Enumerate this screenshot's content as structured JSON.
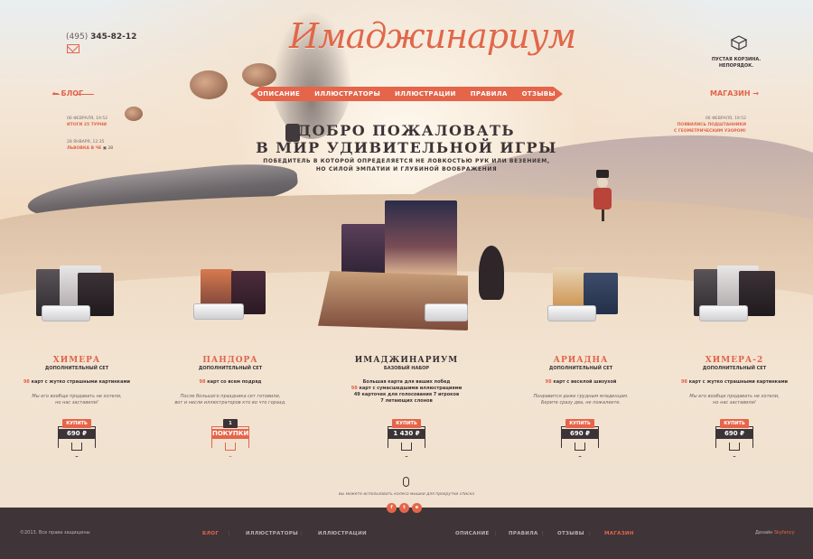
{
  "header": {
    "phone_code": "(495)",
    "phone_number": "345-82-12",
    "logo": "Имаджинариум",
    "nav": [
      "ОПИСАНИЕ",
      "ИЛЛЮСТРАТОРЫ",
      "ИЛЛЮСТРАЦИИ",
      "ПРАВИЛА",
      "ОТЗЫВЫ"
    ],
    "cart_text_1": "ПУСТАЯ КОРЗИНА.",
    "cart_text_2": "НЕПОРЯДОК.",
    "blog_label": "БЛОГ",
    "shop_label": "МАГАЗИН"
  },
  "blog_news": [
    {
      "date": "06 ФЕВРАЛЯ, 19:52",
      "title": "ИТОГИ 25 ТУРНИ"
    },
    {
      "date": "28 ЯНВАРЯ, 12:35",
      "title": "ЛЬВОВКА В ЧЕ",
      "count": "28"
    }
  ],
  "shop_news": {
    "date": "06 ФЕВРАЛЯ, 19:52",
    "title_1": "ПОЯВИЛИСЬ ПОДШТАННИКИ",
    "title_2": "С ГЕОМЕТРИЧЕСКИМ УЗОРОМ!"
  },
  "hero": {
    "title_1": "ДОБРО ПОЖАЛОВАТЬ",
    "title_2": "В МИР УДИВИТЕЛЬНОЙ ИГРЫ",
    "sub_1": "ПОБЕДИТЕЛЬ В КОТОРОЙ ОПРЕДЕЛЯЕТСЯ НЕ ЛОВКОСТЬЮ РУК ИЛИ ВЕЗЕНИЕМ,",
    "sub_2": "НО СИЛОЙ ЭМПАТИИ И ГЛУБИНОЙ ВООБРАЖЕНИЯ"
  },
  "products": [
    {
      "name": "ХИМЕРА",
      "type": "ДОПОЛНИТЕЛЬНЫЙ СЕТ",
      "desc_num": "98",
      "desc": "карт с жутко страшными картинками",
      "quote_1": "Мы его вообще продавать не хотели,",
      "quote_2": "но нас заставили!",
      "buy": "КУПИТЬ",
      "price": "690 ₽"
    },
    {
      "name": "ПАНДОРА",
      "type": "ДОПОЛНИТЕЛЬНЫЙ СЕТ",
      "desc_num": "98",
      "desc": "карт со всем подряд",
      "quote_1": "После большого праздника сет готовили,",
      "quote_2": "вот и несли иллюстраторов кто во что горазд.",
      "buy_count": "1",
      "buy": "ПОКУПКИ"
    },
    {
      "name": "ИМАДЖИНАРИУМ",
      "type": "БАЗОВЫЙ НАБОР",
      "line_1": "Большая карта для ваших побед",
      "line_2_num": "98",
      "line_2": "карт с сумасшедшими иллюстрациями",
      "line_3": "49 карточек для голосования 7 игроков",
      "line_4": "7 летающих слонов",
      "buy": "КУПИТЬ",
      "price": "1 430 ₽"
    },
    {
      "name": "АРИАДНА",
      "type": "ДОПОЛНИТЕЛЬНЫЙ СЕТ",
      "desc_num": "98",
      "desc": "карт с веселой шизухой",
      "quote_1": "Понравится даже грудным младенцам.",
      "quote_2": "Берите сразу два, не пожалеете.",
      "buy": "КУПИТЬ",
      "price": "690 ₽"
    },
    {
      "name": "ХИМЕРА-2",
      "type": "ДОПОЛНИТЕЛЬНЫЙ СЕТ",
      "desc_num": "98",
      "desc": "карт с жутко страшными картинками",
      "quote_1": "Мы его вообще продавать не хотели,",
      "quote_2": "но нас заставили!",
      "buy": "КУПИТЬ",
      "price": "690 ₽"
    }
  ],
  "scroll_hint": "вы можете использовать колесо мышки для прокрутки списка",
  "footer": {
    "copyright": "©2013. Все права защищены",
    "nav": [
      "БЛОГ",
      "ИЛЛЮСТРАТОРЫ",
      "ИЛЛЮСТРАЦИИ",
      "ОПИСАНИЕ",
      "ПРАВИЛА",
      "ОТЗЫВЫ",
      "МАГАЗИН"
    ],
    "design_label": "Дизайн",
    "design_by": "Skyfancy",
    "socials": [
      "f",
      "t",
      "в"
    ]
  },
  "colors": {
    "accent": "#e5654a",
    "dark": "#3f3538"
  }
}
